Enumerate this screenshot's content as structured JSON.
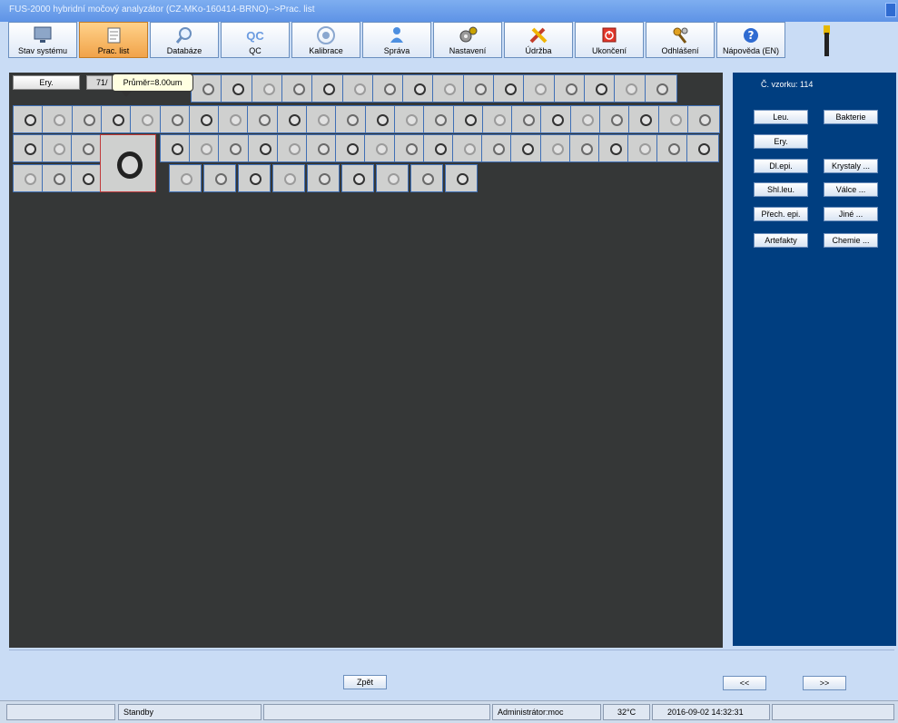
{
  "window": {
    "title": "FUS-2000 hybridní močový analyzátor (CZ-MKo-160414-BRNO)-->Prac. list"
  },
  "toolbar": {
    "items": [
      {
        "label": "Stav systému",
        "icon": "monitor-icon"
      },
      {
        "label": "Prac. list",
        "icon": "worklist-icon",
        "active": true
      },
      {
        "label": "Databáze",
        "icon": "magnifier-icon"
      },
      {
        "label": "QC",
        "icon": "qc-icon"
      },
      {
        "label": "Kalibrace",
        "icon": "target-icon"
      },
      {
        "label": "Správa",
        "icon": "user-icon"
      },
      {
        "label": "Nastavení",
        "icon": "gears-icon"
      },
      {
        "label": "Údržba",
        "icon": "tools-icon"
      },
      {
        "label": "Ukončení",
        "icon": "power-icon"
      },
      {
        "label": "Odhlášení",
        "icon": "keys-icon"
      },
      {
        "label": "Nápověda (EN)",
        "icon": "help-icon"
      }
    ]
  },
  "work": {
    "ery_label": "Ery.",
    "count": "71/",
    "tooltip": "Průměr=8.00um"
  },
  "panel": {
    "sample": "Č. vzorku: 114",
    "buttons": {
      "leu": "Leu.",
      "bakterie": "Bakterie",
      "ery": "Ery.",
      "dlepi": "Dl.epi.",
      "krystaly": "Krystaly ...",
      "shlleu": "Shl.leu.",
      "valce": "Válce ...",
      "prechepi": "Přech. epi.",
      "jine": "Jiné ...",
      "artefakty": "Artefakty",
      "chemie": "Chemie ..."
    }
  },
  "nav": {
    "back": "Zpět",
    "prev": "<<",
    "next": ">>"
  },
  "status": {
    "blank1": "",
    "state": "Standby",
    "blank2": "",
    "user": "Administrátor:moc",
    "temp": "32°C",
    "datetime": "2016-09-02 14:32:31",
    "blank3": ""
  },
  "colors": {
    "active_tab": "#f1a34a",
    "workarea": "#353737",
    "side_panel": "#003e80"
  }
}
